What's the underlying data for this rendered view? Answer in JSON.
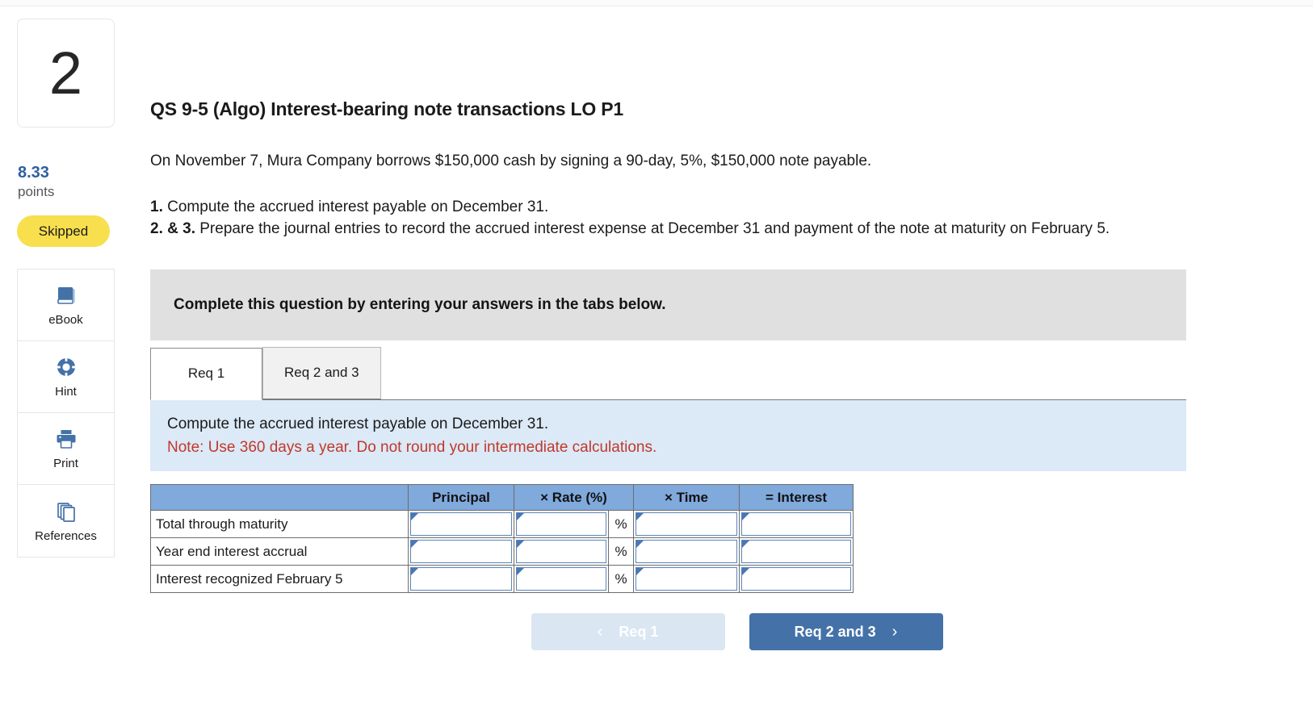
{
  "question": {
    "number": "2",
    "points_value": "8.33",
    "points_label": "points",
    "status_badge": "Skipped",
    "title": "QS 9-5 (Algo) Interest-bearing note transactions LO P1",
    "scenario": "On November 7, Mura Company borrows $150,000 cash by signing a 90-day, 5%, $150,000 note payable.",
    "req1_num": "1.",
    "req1_text": " Compute the accrued interest payable on December 31.",
    "req23_num": "2. & 3.",
    "req23_text": " Prepare the journal entries to record the accrued interest expense at December 31 and payment of the note at maturity on February 5."
  },
  "tools": [
    {
      "label": "eBook",
      "icon": "ebook-icon"
    },
    {
      "label": "Hint",
      "icon": "lifering-icon"
    },
    {
      "label": "Print",
      "icon": "printer-icon"
    },
    {
      "label": "References",
      "icon": "pages-icon"
    }
  ],
  "banner": {
    "text": "Complete this question by entering your answers in the tabs below."
  },
  "tabs": [
    {
      "label": "Req 1",
      "active": true
    },
    {
      "label": "Req 2 and 3",
      "active": false
    }
  ],
  "instructions": {
    "line1": "Compute the accrued interest payable on December 31.",
    "note": "Note: Use 360 days a year. Do not round your intermediate calculations."
  },
  "table": {
    "columns": [
      "",
      "Principal",
      "× Rate (%)",
      "",
      "× Time",
      "= Interest"
    ],
    "percent_symbol": "%",
    "rows": [
      {
        "label": "Total through maturity",
        "principal": "",
        "rate": "",
        "time": "",
        "interest": ""
      },
      {
        "label": "Year end interest accrual",
        "principal": "",
        "rate": "",
        "time": "",
        "interest": ""
      },
      {
        "label": "Interest recognized February 5",
        "principal": "",
        "rate": "",
        "time": "",
        "interest": ""
      }
    ]
  },
  "nav": {
    "prev_label": "Req 1",
    "next_label": "Req 2 and 3",
    "prev_chevron": "‹",
    "next_chevron": "›"
  },
  "colors": {
    "accent_blue": "#4472a8",
    "table_header_blue": "#80a9dc",
    "badge_yellow": "#f7df4e",
    "note_red": "#c0392b",
    "panel_blue": "#dce9f7",
    "banner_gray": "#e0e0e0"
  }
}
